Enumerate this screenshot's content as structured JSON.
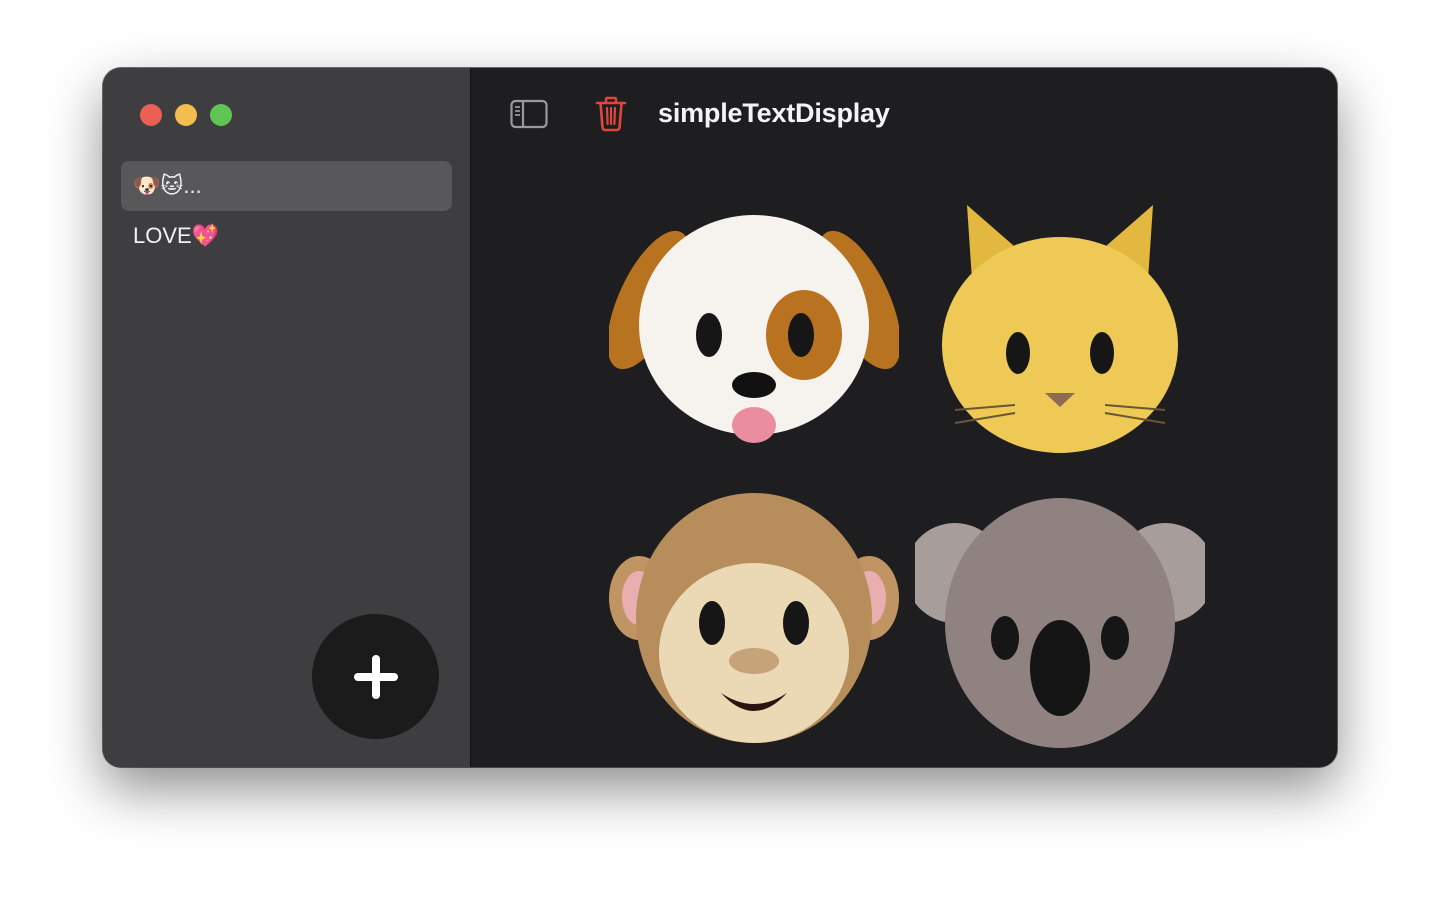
{
  "window": {
    "title": "simpleTextDisplay"
  },
  "sidebar": {
    "items": [
      {
        "label": "🐶🐱...",
        "selected": true
      },
      {
        "label": "LOVE💖",
        "selected": false
      }
    ],
    "add_button_icon": "plus-icon"
  },
  "toolbar": {
    "sidebar_toggle_icon": "sidebar-toggle-icon",
    "trash_icon": "trash-icon",
    "trash_color": "#e0463c"
  },
  "content": {
    "emojis": [
      "🐶",
      "🐱",
      "🐵",
      "🐨"
    ]
  },
  "colors": {
    "sidebar_bg": "#3e3e40",
    "main_bg": "#1e1e20",
    "selected_bg": "#58585a",
    "close": "#ec5f55",
    "minimize": "#f4bd4f",
    "zoom": "#5fc553"
  }
}
